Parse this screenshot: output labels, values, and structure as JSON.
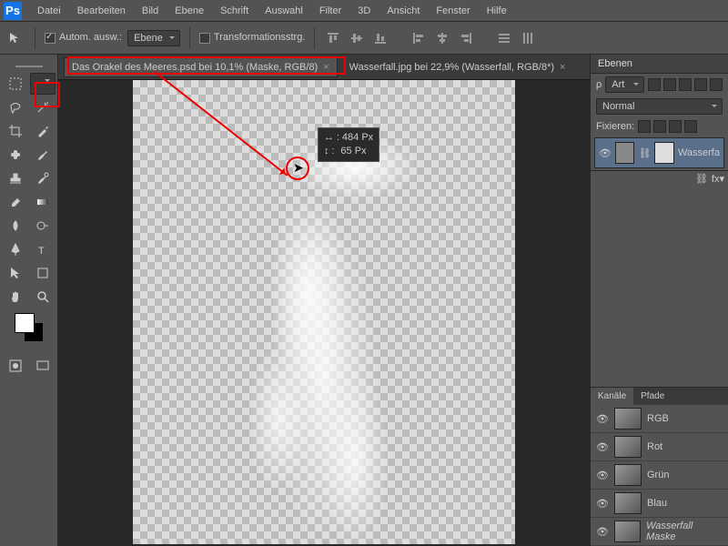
{
  "menu": [
    "Datei",
    "Bearbeiten",
    "Bild",
    "Ebene",
    "Schrift",
    "Auswahl",
    "Filter",
    "3D",
    "Ansicht",
    "Fenster",
    "Hilfe"
  ],
  "options": {
    "auto_select": "Autom. ausw.:",
    "layer_select": "Ebene",
    "transform": "Transformationsstrg."
  },
  "tabs": [
    {
      "title": "Das Orakel des Meeres.psd bei 10,1% (Maske, RGB/8)",
      "active": true
    },
    {
      "title": "Wasserfall.jpg bei 22,9% (Wasserfall, RGB/8*)",
      "active": false
    }
  ],
  "tooltip": {
    "w": "484 Px",
    "h": "65 Px",
    "w_icon": "↔ :",
    "h_icon": "↕ :"
  },
  "panels": {
    "layers_title": "Ebenen",
    "kind": "Art",
    "blend": "Normal",
    "fix": "Fixieren:",
    "layer_name": "Wasserfa",
    "channels_title": "Kanäle",
    "paths_title": "Pfade",
    "channels": [
      "RGB",
      "Rot",
      "Grün",
      "Blau",
      "Wasserfall Maske"
    ]
  }
}
